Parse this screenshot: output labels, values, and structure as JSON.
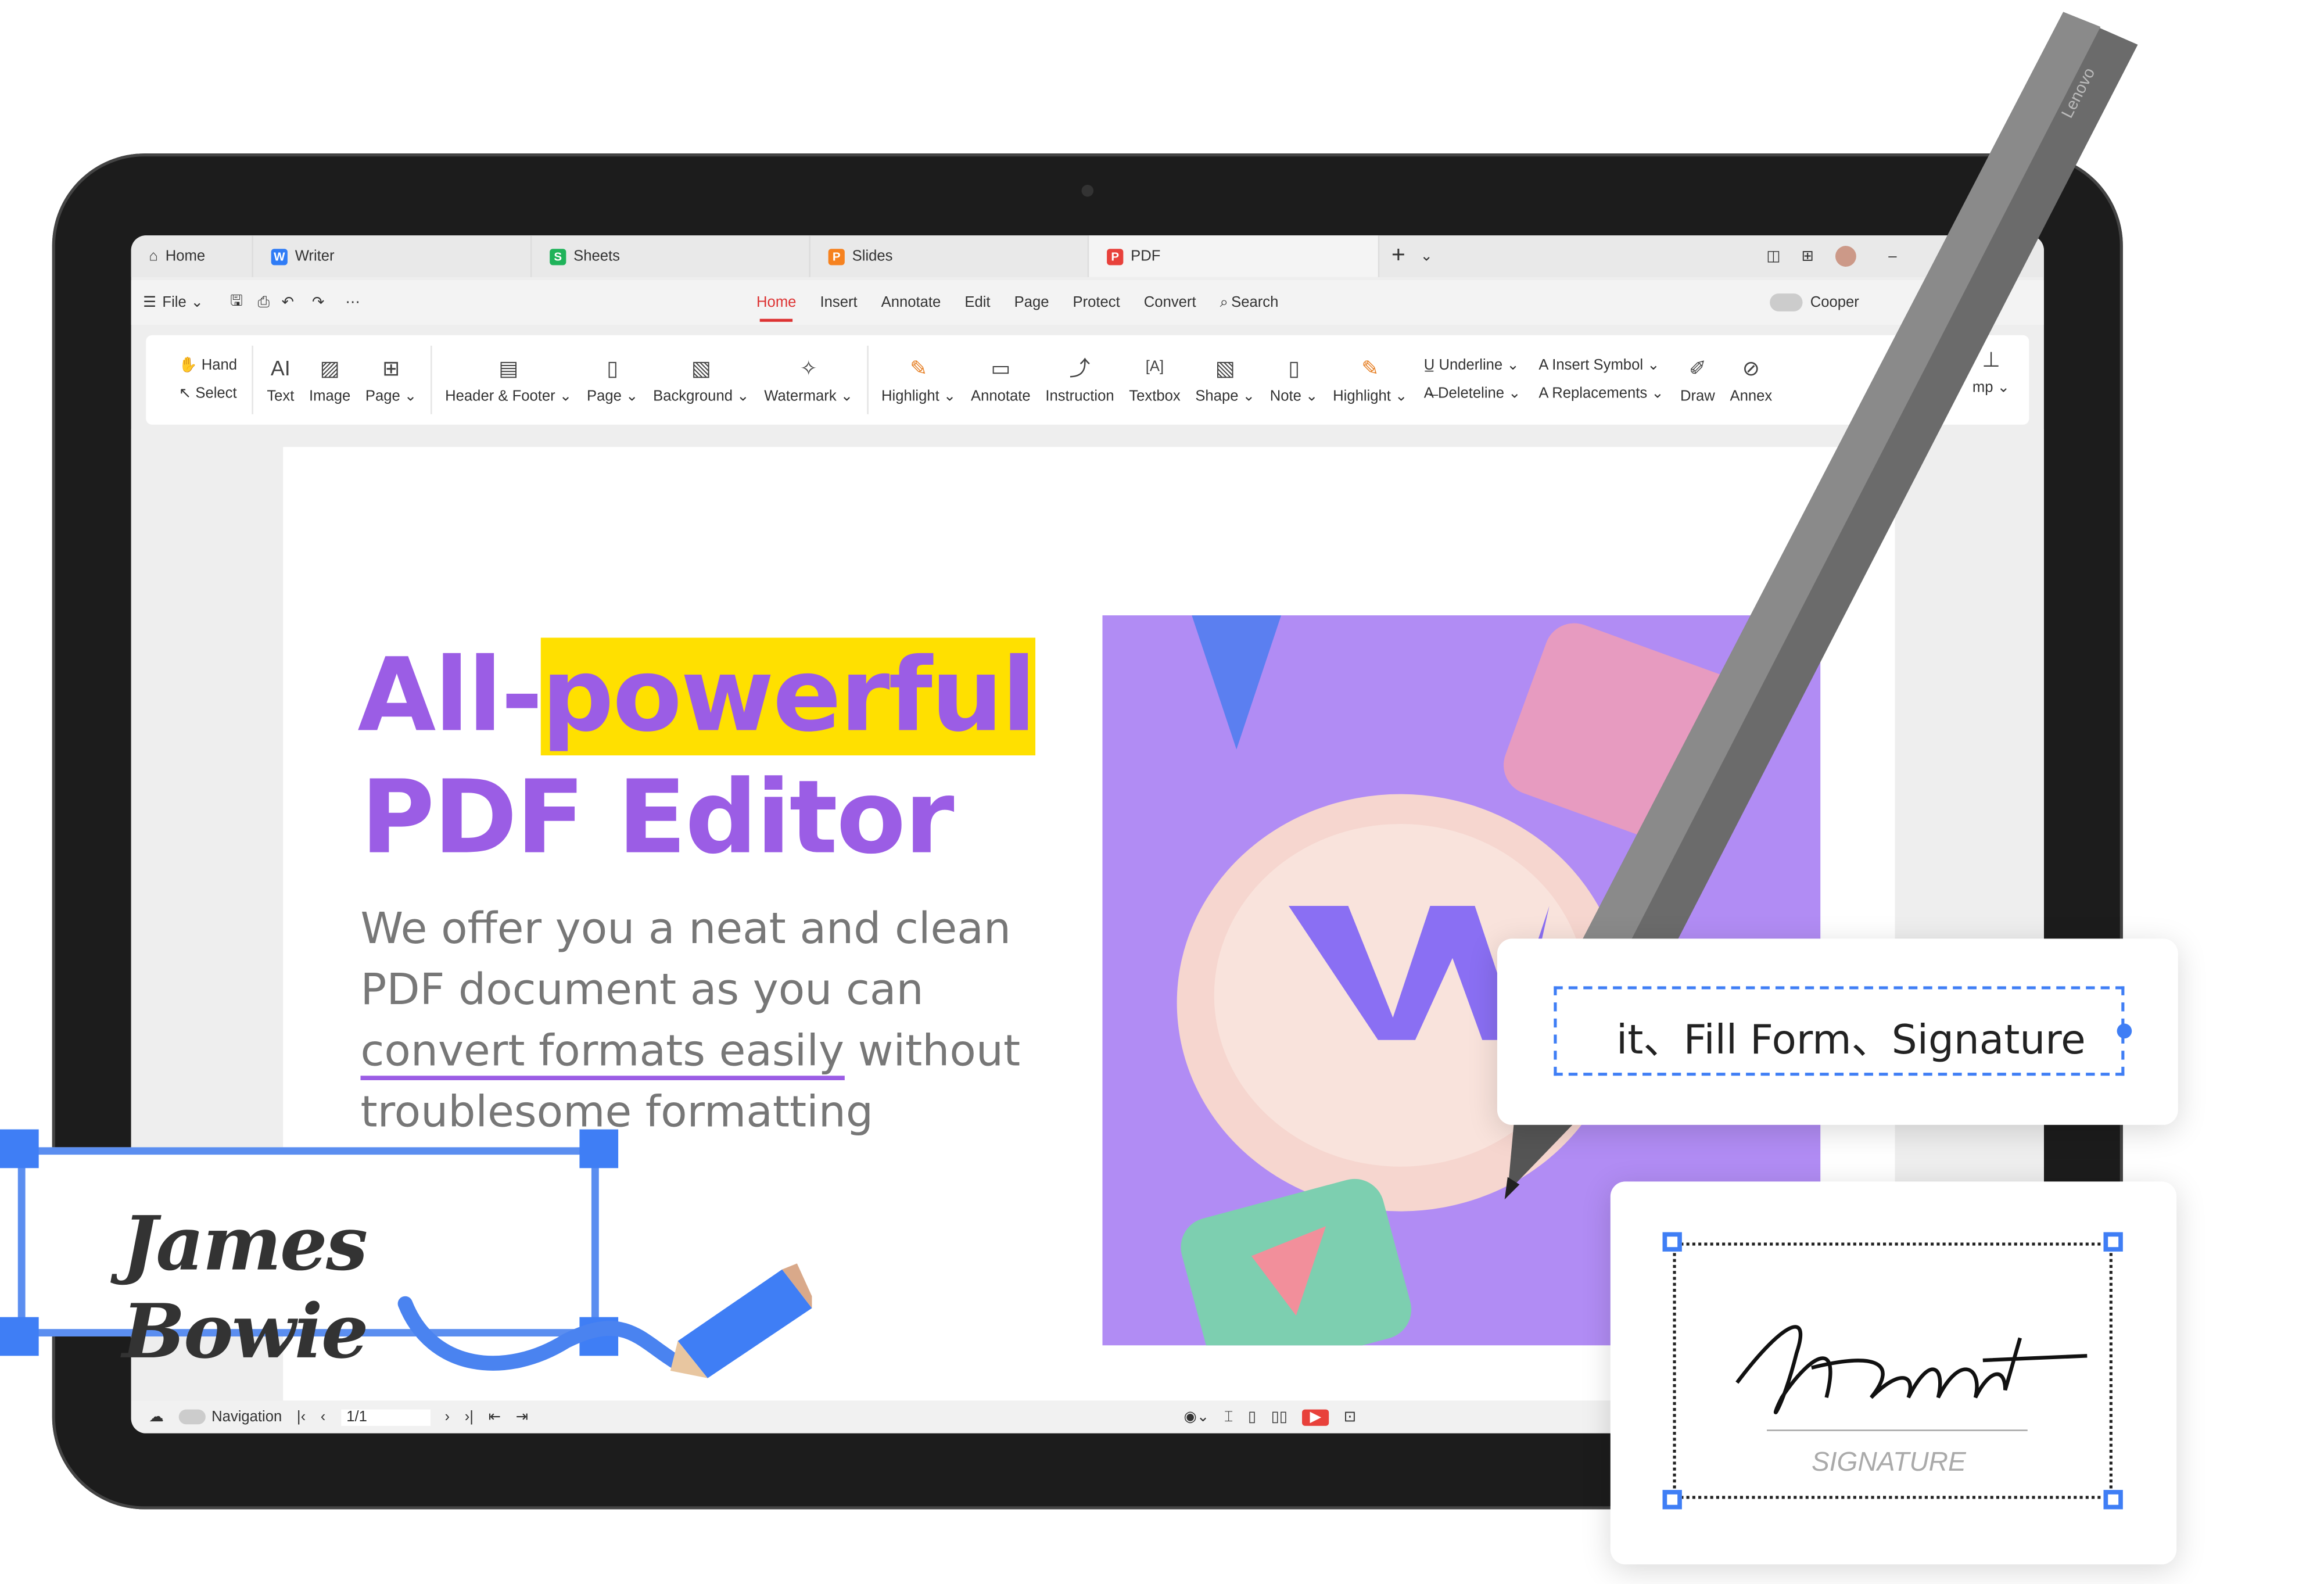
{
  "tabs": [
    {
      "label": "Home",
      "icon": "home-icon"
    },
    {
      "label": "Writer",
      "icon": "W",
      "color": "#2f7cf6"
    },
    {
      "label": "Sheets",
      "icon": "S",
      "color": "#1fb35a"
    },
    {
      "label": "Slides",
      "icon": "P",
      "color": "#f6821f"
    },
    {
      "label": "PDF",
      "icon": "P",
      "color": "#e8413b",
      "active": true
    }
  ],
  "menu": {
    "file": "File",
    "items": [
      "Home",
      "Insert",
      "Annotate",
      "Edit",
      "Page",
      "Protect",
      "Convert"
    ],
    "active": "Home",
    "search": "Search",
    "cooperate": "Cooper"
  },
  "ribbon": {
    "hand": "Hand",
    "select": "Select",
    "tools1": [
      {
        "label": "Text",
        "icon": "AI"
      },
      {
        "label": "Image",
        "icon": "▨"
      },
      {
        "label": "Page ⌄",
        "icon": "⊞"
      }
    ],
    "tools2": [
      {
        "label": "Header & Footer ⌄",
        "icon": "▤"
      },
      {
        "label": "Page ⌄",
        "icon": "▯"
      },
      {
        "label": "Background ⌄",
        "icon": "▧"
      },
      {
        "label": "Watermark ⌄",
        "icon": "✧"
      }
    ],
    "tools3": [
      {
        "label": "Highlight ⌄",
        "icon": "✎"
      },
      {
        "label": "Annotate",
        "icon": "▭"
      },
      {
        "label": "Instruction",
        "icon": "⤴"
      },
      {
        "label": "Textbox",
        "icon": "[A]"
      },
      {
        "label": "Shape ⌄",
        "icon": "▧"
      },
      {
        "label": "Note ⌄",
        "icon": "▯"
      },
      {
        "label": "Highlight ⌄",
        "icon": "✎"
      }
    ],
    "underline": "Underline ⌄",
    "deleteline": "Deleteline ⌄",
    "insert_symbol": "Insert Symbol ⌄",
    "replacements": "Replacements ⌄",
    "tools4": [
      {
        "label": "Draw",
        "icon": "✐"
      },
      {
        "label": "Annex",
        "icon": "⊘"
      }
    ],
    "stamp": "mp ⌄"
  },
  "document": {
    "title1a": "All-",
    "title1b": "powerful",
    "title2": "PDF Editor",
    "para1": "We offer you a neat and clean",
    "para2": "PDF document as you can",
    "para3a": "convert formats easily",
    "para3b": " without",
    "para4": "troublesome formatting"
  },
  "status": {
    "navigation": "Navigation",
    "page": "1/1"
  },
  "callouts": {
    "signature_name": "James Bowie",
    "fill_form": "it、Fill Form、Signature",
    "signature_label": "SIGNATURE",
    "pen_brand": "Lenovo"
  },
  "colors": {
    "accent": "#9b5de5",
    "highlight": "#ffe000",
    "selection": "#3f7ef5",
    "active_tab": "#d33"
  }
}
